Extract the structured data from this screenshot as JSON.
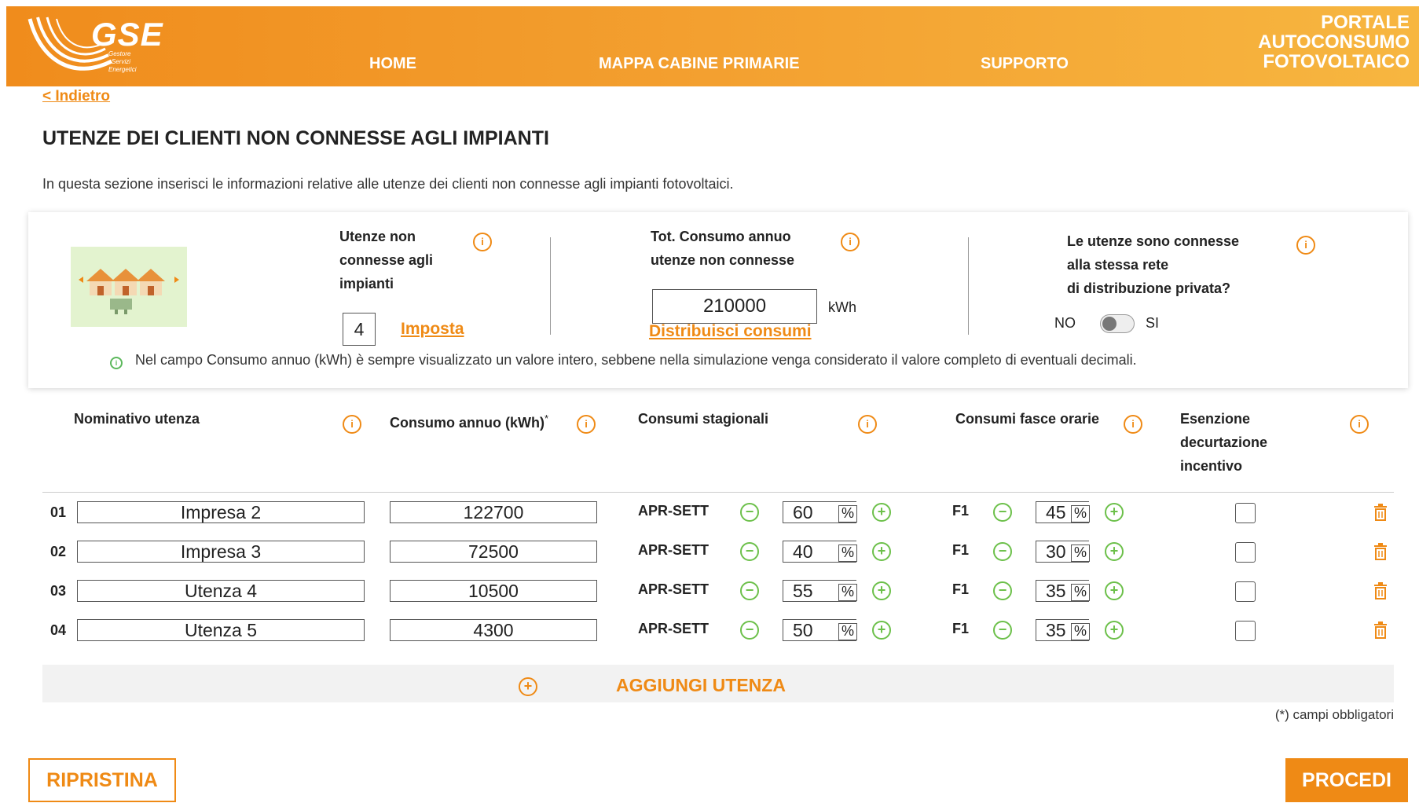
{
  "header": {
    "logo_text": "GSE",
    "logo_sub": [
      "Gestore",
      "Servizi",
      "Energetici"
    ],
    "nav": [
      "HOME",
      "MAPPA CABINE PRIMARIE",
      "SUPPORTO"
    ],
    "portal_title": [
      "PORTALE",
      "AUTOCONSUMO",
      "FOTOVOLTAICO"
    ]
  },
  "back_link": "< Indietro",
  "page_title": "UTENZE DEI CLIENTI NON CONNESSE AGLI IMPIANTI",
  "intro": "In questa sezione inserisci le informazioni relative alle utenze dei clienti non connesse agli impianti fotovoltaici.",
  "panel": {
    "utenze_label": [
      "Utenze non",
      "connesse agli",
      "impianti"
    ],
    "utenze_count": "4",
    "imposta": "Imposta",
    "consumo_label": [
      "Tot. Consumo annuo",
      "utenze non connesse"
    ],
    "consumo_total": "210000",
    "consumo_unit": "kWh",
    "distribuisci": "Distribuisci consumi",
    "rete_label": [
      "Le utenze sono connesse",
      "alla stessa rete",
      "di distribuzione privata?"
    ],
    "toggle_no": "NO",
    "toggle_si": "SI",
    "note": "Nel campo Consumo annuo (kWh) è sempre visualizzato un valore intero, sebbene nella simulazione venga considerato il valore completo di eventuali decimali."
  },
  "table": {
    "headers": {
      "nominativo": "Nominativo utenza",
      "consumo": "Consumo annuo (kWh)",
      "consumo_star": "*",
      "stagionali": "Consumi stagionali",
      "fasce": "Consumi fasce orarie",
      "esenzione": [
        "Esenzione",
        "decurtazione",
        "incentivo"
      ]
    },
    "rows": [
      {
        "num": "01",
        "name": "Impresa 2",
        "consumo": "122700",
        "season": "APR-SETT",
        "season_pct": "60",
        "fascia": "F1",
        "fascia_pct": "45",
        "pct_sign": "%"
      },
      {
        "num": "02",
        "name": "Impresa 3",
        "consumo": "72500",
        "season": "APR-SETT",
        "season_pct": "40",
        "fascia": "F1",
        "fascia_pct": "30",
        "pct_sign": "%"
      },
      {
        "num": "03",
        "name": "Utenza 4",
        "consumo": "10500",
        "season": "APR-SETT",
        "season_pct": "55",
        "fascia": "F1",
        "fascia_pct": "35",
        "pct_sign": "%"
      },
      {
        "num": "04",
        "name": "Utenza 5",
        "consumo": "4300",
        "season": "APR-SETT",
        "season_pct": "50",
        "fascia": "F1",
        "fascia_pct": "35",
        "pct_sign": "%"
      }
    ]
  },
  "add_utenza": "AGGIUNGI UTENZA",
  "required_note": "(*) campi obbligatori",
  "buttons": {
    "reset": "RIPRISTINA",
    "proceed": "PROCEDI"
  },
  "colors": {
    "accent": "#ef8a15",
    "plus_minus": "#6cc04a",
    "note_icon": "#5cb85c"
  }
}
